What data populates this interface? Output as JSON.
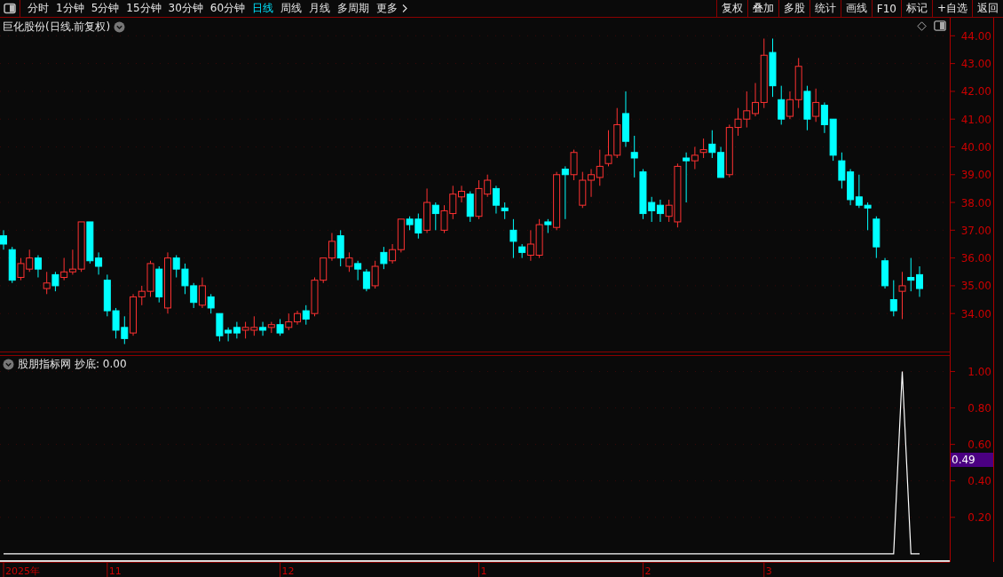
{
  "toolbar": {
    "periods": [
      {
        "label": "分时",
        "selected": false
      },
      {
        "label": "1分钟",
        "selected": false
      },
      {
        "label": "5分钟",
        "selected": false
      },
      {
        "label": "15分钟",
        "selected": false
      },
      {
        "label": "30分钟",
        "selected": false
      },
      {
        "label": "60分钟",
        "selected": false
      },
      {
        "label": "日线",
        "selected": true
      },
      {
        "label": "周线",
        "selected": false
      },
      {
        "label": "月线",
        "selected": false
      },
      {
        "label": "多周期",
        "selected": false
      }
    ],
    "more": "更多",
    "buttons": [
      "复权",
      "叠加",
      "多股",
      "统计",
      "画线",
      "F10",
      "标记",
      "+自选",
      "返回"
    ]
  },
  "price_pane": {
    "title": "巨化股份(日线.前复权)",
    "chart_data": {
      "type": "candlestick",
      "grid": true,
      "ylim": [
        32.6,
        44.65
      ],
      "yticks": [
        {
          "value": 44,
          "label": "44.00"
        },
        {
          "value": 43,
          "label": "43.00"
        },
        {
          "value": 42,
          "label": "42.00"
        },
        {
          "value": 41,
          "label": "41.00"
        },
        {
          "value": 40,
          "label": "40.00"
        },
        {
          "value": 39,
          "label": "39.00"
        },
        {
          "value": 38,
          "label": "38.00"
        },
        {
          "value": 37,
          "label": "37.00"
        },
        {
          "value": 36,
          "label": "36.00"
        },
        {
          "value": 35,
          "label": "35.00"
        },
        {
          "value": 34,
          "label": "34.00"
        }
      ],
      "ohlc": [
        [
          36.8,
          37.0,
          36.3,
          36.5
        ],
        [
          36.3,
          36.4,
          35.1,
          35.2
        ],
        [
          35.3,
          36.0,
          35.2,
          35.8
        ],
        [
          35.6,
          36.3,
          35.5,
          36.0
        ],
        [
          36.0,
          36.1,
          35.3,
          35.6
        ],
        [
          34.9,
          35.5,
          34.7,
          35.1
        ],
        [
          35.4,
          35.5,
          34.8,
          35.0
        ],
        [
          35.3,
          36.0,
          35.2,
          35.5
        ],
        [
          35.5,
          36.3,
          35.4,
          35.6
        ],
        [
          35.6,
          37.3,
          35.5,
          37.3
        ],
        [
          37.3,
          37.3,
          35.8,
          35.9
        ],
        [
          36.0,
          36.2,
          35.4,
          35.7
        ],
        [
          35.2,
          35.4,
          33.9,
          34.1
        ],
        [
          34.1,
          34.2,
          33.1,
          33.4
        ],
        [
          33.5,
          33.9,
          32.9,
          33.1
        ],
        [
          33.3,
          34.7,
          33.2,
          34.6
        ],
        [
          34.6,
          35.0,
          34.3,
          34.8
        ],
        [
          34.8,
          35.9,
          34.6,
          35.8
        ],
        [
          35.6,
          35.7,
          34.4,
          34.6
        ],
        [
          34.2,
          36.2,
          34.0,
          36.0
        ],
        [
          36.0,
          36.1,
          35.3,
          35.6
        ],
        [
          35.6,
          35.8,
          34.7,
          35.0
        ],
        [
          35.0,
          35.1,
          34.2,
          34.4
        ],
        [
          34.3,
          35.3,
          34.2,
          35.0
        ],
        [
          34.6,
          34.7,
          34.0,
          34.2
        ],
        [
          34.0,
          34.0,
          33.0,
          33.2
        ],
        [
          33.4,
          33.5,
          33.0,
          33.3
        ],
        [
          33.5,
          33.7,
          33.1,
          33.3
        ],
        [
          33.4,
          33.7,
          33.1,
          33.5
        ],
        [
          33.4,
          33.9,
          33.2,
          33.5
        ],
        [
          33.5,
          33.7,
          33.2,
          33.4
        ],
        [
          33.5,
          33.7,
          33.3,
          33.6
        ],
        [
          33.6,
          33.8,
          33.2,
          33.3
        ],
        [
          33.5,
          34.0,
          33.4,
          33.7
        ],
        [
          33.7,
          34.1,
          33.6,
          34.0
        ],
        [
          34.1,
          34.3,
          33.6,
          33.8
        ],
        [
          34.0,
          35.3,
          33.9,
          35.2
        ],
        [
          35.2,
          36.0,
          35.1,
          36.0
        ],
        [
          36.0,
          36.9,
          35.9,
          36.6
        ],
        [
          36.8,
          37.0,
          35.7,
          36.0
        ],
        [
          35.7,
          36.2,
          35.5,
          36.0
        ],
        [
          35.8,
          35.9,
          35.2,
          35.6
        ],
        [
          35.5,
          35.6,
          34.8,
          34.9
        ],
        [
          35.0,
          35.9,
          34.9,
          35.7
        ],
        [
          36.2,
          36.4,
          35.6,
          35.8
        ],
        [
          35.9,
          36.5,
          35.8,
          36.3
        ],
        [
          36.3,
          37.4,
          36.2,
          37.4
        ],
        [
          37.4,
          37.5,
          37.0,
          37.2
        ],
        [
          37.4,
          37.6,
          36.7,
          36.9
        ],
        [
          37.0,
          38.5,
          36.9,
          38.0
        ],
        [
          37.9,
          38.0,
          37.0,
          37.6
        ],
        [
          37.0,
          37.9,
          36.9,
          37.7
        ],
        [
          37.6,
          38.6,
          37.4,
          38.3
        ],
        [
          38.2,
          38.6,
          38.0,
          38.4
        ],
        [
          38.3,
          38.4,
          37.3,
          37.5
        ],
        [
          37.5,
          38.8,
          37.4,
          38.5
        ],
        [
          38.3,
          39.0,
          38.2,
          38.8
        ],
        [
          38.5,
          38.6,
          37.6,
          37.9
        ],
        [
          37.8,
          38.0,
          37.4,
          37.7
        ],
        [
          37.0,
          37.4,
          36.0,
          36.6
        ],
        [
          36.4,
          36.5,
          36.0,
          36.2
        ],
        [
          36.1,
          37.0,
          35.9,
          36.5
        ],
        [
          36.1,
          37.4,
          36.0,
          37.2
        ],
        [
          37.3,
          37.4,
          36.9,
          37.2
        ],
        [
          37.1,
          39.1,
          37.0,
          39.0
        ],
        [
          39.2,
          39.3,
          37.4,
          39.0
        ],
        [
          39.0,
          39.9,
          38.8,
          39.8
        ],
        [
          37.9,
          39.1,
          37.8,
          38.8
        ],
        [
          38.8,
          39.2,
          38.2,
          39.0
        ],
        [
          38.9,
          39.9,
          38.6,
          39.3
        ],
        [
          39.4,
          40.6,
          39.3,
          39.7
        ],
        [
          39.7,
          41.4,
          39.6,
          40.8
        ],
        [
          41.2,
          42.0,
          40.0,
          40.2
        ],
        [
          39.8,
          40.4,
          38.9,
          39.6
        ],
        [
          39.1,
          39.2,
          37.4,
          37.6
        ],
        [
          38.0,
          38.2,
          37.3,
          37.7
        ],
        [
          37.9,
          38.1,
          37.3,
          37.6
        ],
        [
          37.5,
          38.1,
          37.3,
          37.9
        ],
        [
          37.3,
          39.4,
          37.1,
          39.3
        ],
        [
          39.6,
          39.8,
          38.0,
          39.5
        ],
        [
          39.5,
          40.0,
          39.2,
          39.7
        ],
        [
          39.8,
          40.3,
          39.6,
          39.9
        ],
        [
          40.1,
          40.6,
          39.6,
          39.8
        ],
        [
          39.8,
          40.0,
          38.9,
          38.9
        ],
        [
          39.0,
          40.8,
          38.9,
          40.7
        ],
        [
          40.7,
          41.4,
          40.4,
          41.0
        ],
        [
          41.0,
          42.0,
          40.7,
          41.3
        ],
        [
          41.2,
          42.3,
          41.1,
          41.6
        ],
        [
          41.6,
          43.9,
          41.4,
          43.3
        ],
        [
          43.4,
          43.9,
          41.8,
          42.2
        ],
        [
          41.7,
          42.2,
          40.8,
          41.0
        ],
        [
          41.1,
          42.0,
          41.0,
          41.7
        ],
        [
          41.7,
          43.2,
          41.4,
          42.9
        ],
        [
          42.0,
          42.2,
          40.6,
          41.0
        ],
        [
          41.1,
          42.1,
          40.9,
          41.6
        ],
        [
          41.5,
          41.6,
          40.5,
          40.8
        ],
        [
          41.0,
          41.0,
          39.5,
          39.7
        ],
        [
          39.5,
          39.8,
          38.5,
          38.8
        ],
        [
          39.1,
          39.2,
          37.9,
          38.1
        ],
        [
          38.2,
          39.0,
          37.8,
          37.9
        ],
        [
          37.9,
          38.0,
          37.0,
          37.8
        ],
        [
          37.4,
          37.5,
          36.0,
          36.4
        ],
        [
          35.9,
          36.0,
          34.9,
          35.0
        ],
        [
          34.5,
          35.2,
          33.9,
          34.1
        ],
        [
          34.8,
          35.5,
          33.8,
          35.0
        ],
        [
          35.3,
          36.0,
          34.8,
          35.2
        ],
        [
          35.4,
          35.7,
          34.6,
          34.9
        ]
      ]
    }
  },
  "date_axis": [
    "2025年",
    "11",
    "12",
    "1",
    "2",
    "3"
  ],
  "indicator_pane": {
    "name": "股朋指标网",
    "value": ": 0.00",
    "cursor_value": "0.49",
    "chart_data": {
      "type": "line",
      "grid": true,
      "ylim": [
        -0.03,
        1.09
      ],
      "yticks": [
        {
          "value": 1,
          "label": "1.00"
        },
        {
          "value": 0.8,
          "label": "0.80"
        },
        {
          "value": 0.6,
          "label": "0.60"
        },
        {
          "value": 0.4,
          "label": "0.40"
        },
        {
          "value": 0.2,
          "label": "0.20"
        }
      ],
      "series": [
        {
          "name": "抄底",
          "color": "#ffffff",
          "values": [
            0,
            0,
            0,
            0,
            0,
            0,
            0,
            0,
            0,
            0,
            0,
            0,
            0,
            0,
            0,
            0,
            0,
            0,
            0,
            0,
            0,
            0,
            0,
            0,
            0,
            0,
            0,
            0,
            0,
            0,
            0,
            0,
            0,
            0,
            0,
            0,
            0,
            0,
            0,
            0,
            0,
            0,
            0,
            0,
            0,
            0,
            0,
            0,
            0,
            0,
            0,
            0,
            0,
            0,
            0,
            0,
            0,
            0,
            0,
            0,
            0,
            0,
            0,
            0,
            0,
            0,
            0,
            0,
            0,
            0,
            0,
            0,
            0,
            0,
            0,
            0,
            0,
            0,
            0,
            0,
            0,
            0,
            0,
            0,
            0,
            0,
            0,
            0,
            0,
            0,
            0,
            0,
            0,
            0,
            0,
            0,
            0,
            0,
            0,
            0,
            0,
            0,
            0,
            0,
            1,
            0,
            0
          ]
        }
      ]
    }
  }
}
